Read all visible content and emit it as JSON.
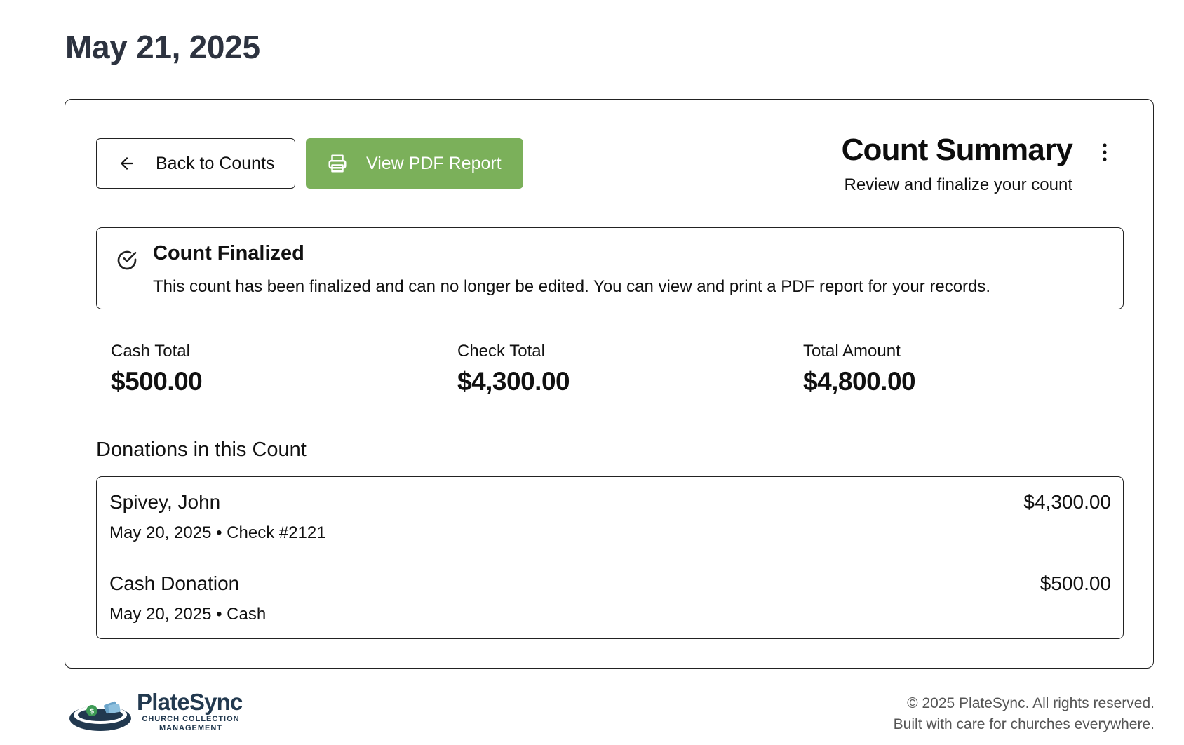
{
  "page": {
    "title": "May 21, 2025"
  },
  "toolbar": {
    "back_label": "Back to Counts",
    "pdf_label": "View PDF Report",
    "pdf_color": "#7bb05a"
  },
  "summary": {
    "title": "Count Summary",
    "subtitle": "Review and finalize your count"
  },
  "alert": {
    "title": "Count Finalized",
    "message": "This count has been finalized and can no longer be edited. You can view and print a PDF report for your records."
  },
  "totals": [
    {
      "label": "Cash Total",
      "value": "$500.00"
    },
    {
      "label": "Check Total",
      "value": "$4,300.00"
    },
    {
      "label": "Total Amount",
      "value": "$4,800.00"
    }
  ],
  "donations": {
    "title": "Donations in this Count",
    "items": [
      {
        "name": "Spivey, John",
        "meta": "May 20, 2025 • Check #2121",
        "amount": "$4,300.00"
      },
      {
        "name": "Cash Donation",
        "meta": "May 20, 2025 • Cash",
        "amount": "$500.00"
      }
    ]
  },
  "footer": {
    "brand": "PlateSync",
    "tagline": "CHURCH COLLECTION MANAGEMENT",
    "copyright": "© 2025 PlateSync. All rights reserved.",
    "note": "Built with care for churches everywhere."
  }
}
